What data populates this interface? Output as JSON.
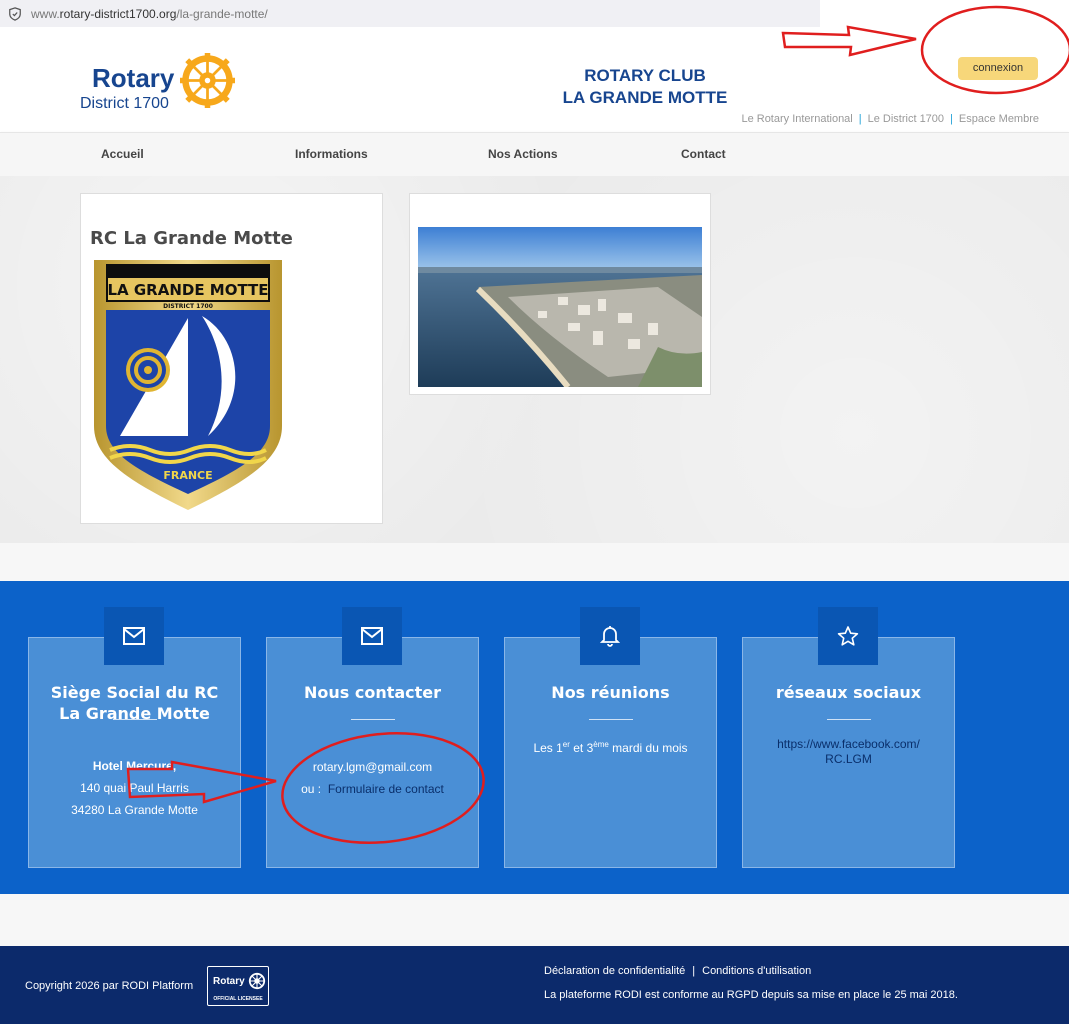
{
  "browser": {
    "url_prefix": "www.",
    "url_host": "rotary-district1700.org",
    "url_path": "/la-grande-motte/"
  },
  "header": {
    "logo_word": "Rotary",
    "logo_district": "District 1700",
    "club_title_line1": "ROTARY CLUB",
    "club_title_line2": "LA GRANDE MOTTE",
    "connexion_label": "connexion",
    "top_links": [
      "Le Rotary International",
      "Le District 1700",
      "Espace Membre"
    ]
  },
  "nav": {
    "items": [
      "Accueil",
      "Informations",
      "Nos Actions",
      "Contact"
    ]
  },
  "main": {
    "card_title": "RC La Grande Motte",
    "banner_top_text": "LA GRANDE MOTTE",
    "banner_sub_text": "DISTRICT 1700",
    "banner_bottom_text": "FRANCE"
  },
  "info": {
    "siege": {
      "title": "Siège Social du RC La Grande Motte",
      "line1": "Hotel Mercure,",
      "line2": "140 quai Paul Harris",
      "line3": "34280 La Grande Motte"
    },
    "contact": {
      "title": "Nous contacter",
      "email": "rotary.lgm@gmail.com",
      "or_label": "ou :",
      "form_link": "Formulaire de contact"
    },
    "reunions": {
      "title": "Nos réunions",
      "text_pre": "Les 1",
      "sup1": "er",
      "text_mid": " et 3",
      "sup2": "ème",
      "text_post": " mardi du mois"
    },
    "social": {
      "title": "réseaux sociaux",
      "link_line1": "https://www.facebook.com/",
      "link_line2": "RC.LGM"
    }
  },
  "footer": {
    "copyright": "Copyright 2026 par RODI Platform",
    "license_word": "Rotary",
    "license_label": "OFFICIAL LICENSEE",
    "privacy": "Déclaration de confidentialité",
    "terms": "Conditions d'utilisation",
    "rgpd": "La plateforme RODI est conforme au RGPD depuis sa mise en place le 25 mai 2018."
  },
  "colors": {
    "rotary_blue": "#17458f",
    "rotary_gold": "#f7a81b",
    "info_bg": "#0c62c9",
    "footer_bg": "#0c2a6b",
    "annotation_red": "#e01e1e"
  }
}
